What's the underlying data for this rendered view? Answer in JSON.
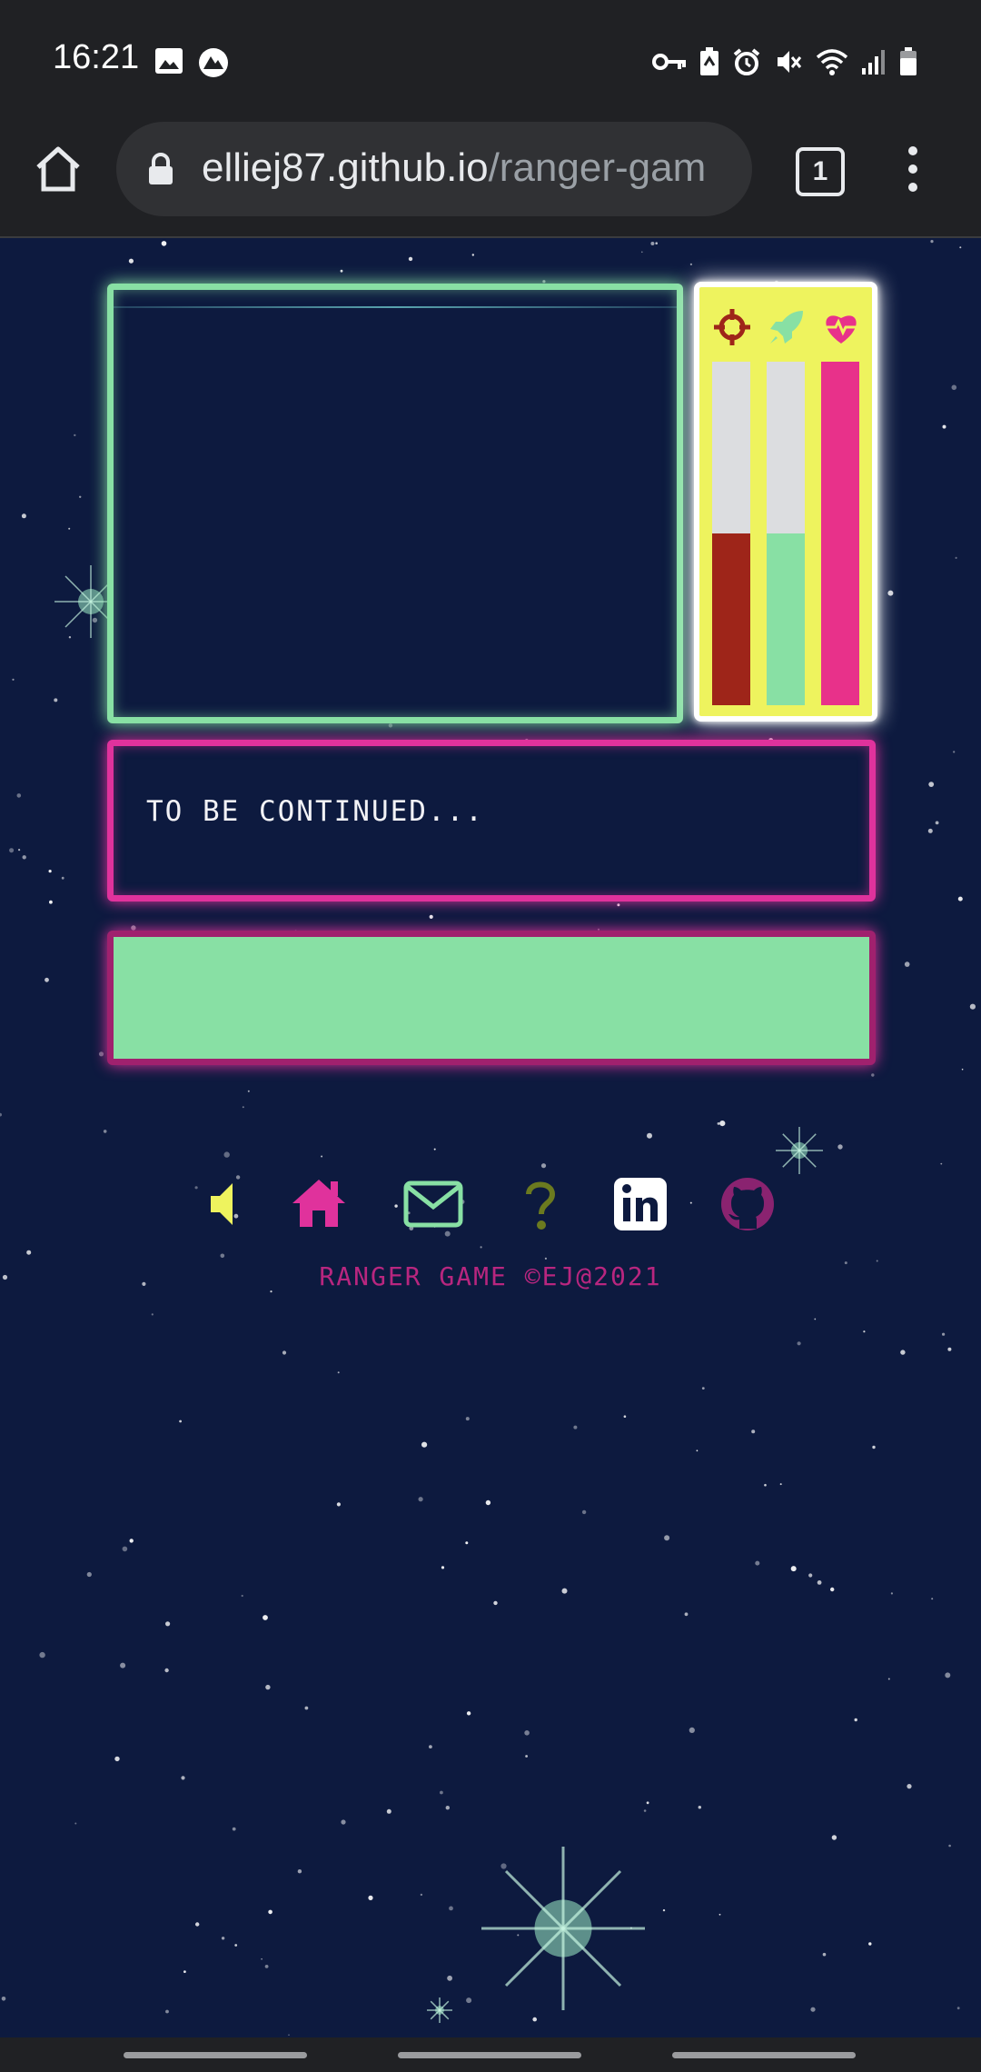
{
  "status_bar": {
    "time": "16:21",
    "left_icons": [
      "image-icon",
      "app-notification-icon"
    ],
    "right_icons": [
      "vpn-key-icon",
      "battery-saver-icon",
      "alarm-icon",
      "mute-icon",
      "wifi-icon",
      "signal-icon",
      "battery-icon"
    ]
  },
  "browser": {
    "url_host": "elliej87.github.io",
    "url_path": "/ranger-gam",
    "tab_count": "1"
  },
  "game": {
    "stats": [
      {
        "name": "attack",
        "icon": "crosshair-icon",
        "color": "#9e2519",
        "level_percent": 50
      },
      {
        "name": "speed",
        "icon": "rocket-icon",
        "color": "#88e0a4",
        "level_percent": 50
      },
      {
        "name": "health",
        "icon": "heart-pulse-icon",
        "color": "#e8318a",
        "level_percent": 100
      }
    ],
    "message": "TO BE CONTINUED...",
    "action_button_label": ""
  },
  "footer": {
    "icons": [
      {
        "name": "sound-icon",
        "color": "#eef35e"
      },
      {
        "name": "home-icon",
        "color": "#e0329c"
      },
      {
        "name": "mail-icon",
        "color": "#88e0a4"
      },
      {
        "name": "help-icon",
        "color": "#6b7a1f"
      },
      {
        "name": "linkedin-icon",
        "color": "#ffffff"
      },
      {
        "name": "github-icon",
        "color": "#8a2370"
      }
    ],
    "copyright": "RANGER GAME ©EJ@2021"
  },
  "colors": {
    "background": "#0d1a3f",
    "accent_green": "#88e0a4",
    "accent_pink": "#e0329c",
    "accent_yellow": "#eef35e"
  }
}
